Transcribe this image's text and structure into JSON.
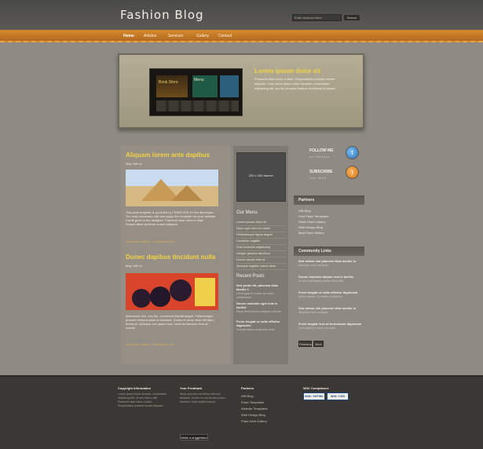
{
  "header": {
    "logo": "Fashion Blog",
    "search_placeholder": "Enter keyword here",
    "search_button": "Search"
  },
  "nav": {
    "items": [
      "Home",
      "Articles",
      "Services",
      "Gallery",
      "Contact"
    ]
  },
  "featured": {
    "title": "Lorem ipsum dolor sit",
    "text": "Praesent vitae tortor a diam. Suspendisse pulvinar ornare aliquam. Cras lorem ipsum dolor sit amet, consectetur adipiscing elit, sed do eiusmod tempor incididunt ut labore.",
    "image_labels": {
      "store": "Book Store",
      "panel": "Menu"
    }
  },
  "posts": [
    {
      "title": "Aliquam lorem ante dapibus",
      "meta": "May 26th in",
      "text": "This post template is provided by TEMPLATE for the developer. You may download, edit and apply this template for your website. Credit goes to the designer. Praesent vitae tortor a diam. Suspendisse pulvinar ornare aliquam.",
      "more": "Continue reading  ·  Comments (10)"
    },
    {
      "title": "Donec dapibus tincidunt nulla",
      "meta": "May 24th in",
      "text": "Maecenas nec, nec leo, commodo blandit augue. Pellentesque posuere tempus justo id tincidunt. Donec et tortor vitae elit kipro tincidunt. Quisque non ipsum erat. Nulla fermentum eros at mauris.",
      "more": "Continue reading  ·  Comments (10)"
    }
  ],
  "ad": {
    "text": "250 x 250 banner"
  },
  "menu": {
    "heading": "Our Menu",
    "links": [
      "Lorem ipsum dolor sit",
      "Nunc quis nisi non tellus",
      "Pellentesque ligula augue",
      "Curabitur sagittis",
      "Duis molestie adipiscing",
      "Integer gravida faucibus",
      "Donec iaculis felis id",
      "Quisque sagittis varius diam"
    ]
  },
  "recent": {
    "heading": "Recent Posts",
    "items": [
      {
        "title": "Sed porta elit, placerat vitae iaculis 1",
        "text": "Ut feugiat in lorem ac nulla vestibulum"
      },
      {
        "title": "Donec molestie eget erat in facilisi",
        "text": "Nunc fermentum aliquam rutrum"
      },
      {
        "title": "Proin feugiat ut nulla efficitur dignissim",
        "text": "Suspendisse euismod dolor"
      }
    ]
  },
  "sidebar": {
    "follow_title": "FOLLOW ME",
    "follow_sub": "on twitter",
    "subscribe_title": "SUBSCRIBE",
    "subscribe_sub": "rss feed",
    "partners_heading": "Partners",
    "partners": [
      "WB Blog",
      "Free Flash Templates",
      "Flash Flash Gallery",
      "Web Design Blog",
      "Best Flash Gallery"
    ],
    "community_heading": "Community Links",
    "community": [
      {
        "title": "Sed metus nisi placerat vitae iaculis in",
        "text": "Aliquam erat volutpat"
      },
      {
        "title": "Donec molestie aliquet erat in facilisi",
        "text": "In hac habitasse platea dictumst"
      },
      {
        "title": "Proin feugiat ut nulla efficitur dignissim",
        "text": "Nulla facilisi. Curabitur eleifend"
      },
      {
        "title": "Sed metus nisi placerat vitae iaculis in",
        "text": "Aliquam erat volutpat"
      },
      {
        "title": "Proin feugiat eros at fermentum dignissim",
        "text": "Ut feugiat in lorem ac nulla"
      }
    ],
    "btn_prev": "Previous",
    "btn_next": "Next"
  },
  "footer": {
    "col1_head": "Copyright information",
    "col1_text": "Lorem ipsum dolor sit amet, consectetur adipiscing elit. Ut sed erat a velit. Praesent vitae tortor a diam. Suspendisse pulvinar ornare aliquam.",
    "col2_head": "Your Feedback",
    "col2_text": "Nunc quis nisi non tellus vehicula faucibus. Donec eu orci at nisl cursus tincidunt. Nulla facilisi mauris.",
    "suggestion": "Make a suggestion",
    "col3_head": "Partners",
    "col3_links": [
      "WB Blog",
      "Flash Templates",
      "Website Templates",
      "Web Design Blog",
      "Flash Web Gallery"
    ],
    "col4_head": "W3C Compliance",
    "badge1": "W3C XHTML",
    "badge2": "W3C CSS"
  }
}
